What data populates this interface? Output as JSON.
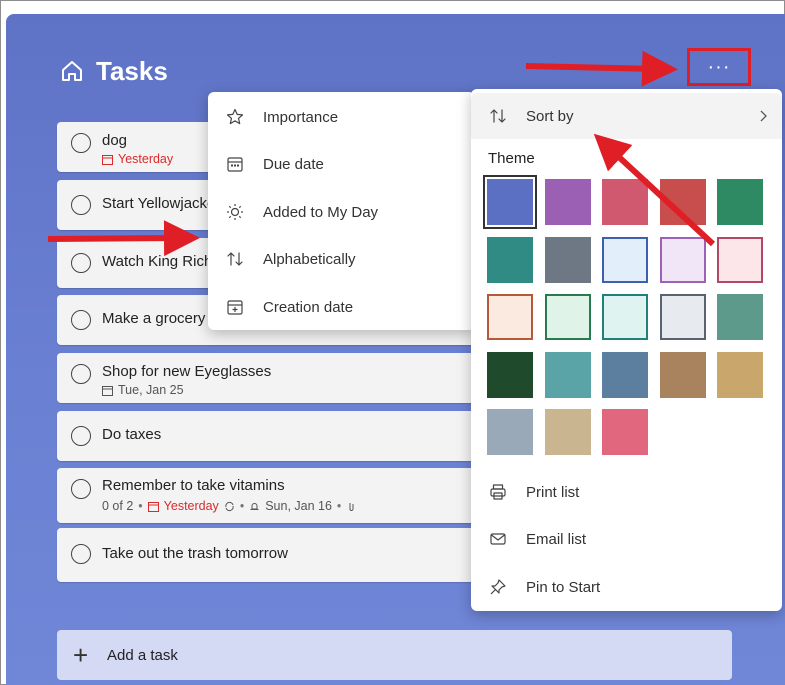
{
  "app": {
    "title": "Tasks",
    "more_label": "···"
  },
  "tasks": [
    {
      "title": "dog",
      "due": "Yesterday",
      "due_overdue": true
    },
    {
      "title": "Start Yellowjackets"
    },
    {
      "title": "Watch King Richard"
    },
    {
      "title": "Make a grocery list"
    },
    {
      "title": "Shop for new Eyeglasses",
      "due": "Tue, Jan 25",
      "due_overdue": false
    },
    {
      "title": "Do taxes"
    },
    {
      "title": "Remember to take vitamins",
      "steps": "0 of 2",
      "due": "Yesterday",
      "due_overdue": true,
      "reminder": "Sun, Jan 16"
    },
    {
      "title": "Take out the trash tomorrow"
    }
  ],
  "add_task": {
    "label": "Add a task"
  },
  "sort_menu": {
    "items": [
      {
        "label": "Importance",
        "icon": "star-icon"
      },
      {
        "label": "Due date",
        "icon": "calendar-icon"
      },
      {
        "label": "Added to My Day",
        "icon": "sun-icon"
      },
      {
        "label": "Alphabetically",
        "icon": "sort-arrows-icon"
      },
      {
        "label": "Creation date",
        "icon": "calendar-add-icon"
      }
    ]
  },
  "list_menu": {
    "sort_by": "Sort by",
    "theme_label": "Theme",
    "print": "Print list",
    "email": "Email list",
    "pin": "Pin to Start"
  },
  "themes": [
    {
      "name": "blue",
      "color": "#5b6fc3",
      "selected": true
    },
    {
      "name": "purple",
      "color": "#9b5fb4"
    },
    {
      "name": "pink",
      "color": "#d0596f"
    },
    {
      "name": "red",
      "color": "#c84e4e"
    },
    {
      "name": "green",
      "color": "#2e8a62"
    },
    {
      "name": "teal",
      "color": "#2f8b84"
    },
    {
      "name": "gray",
      "color": "#6e7884"
    },
    {
      "name": "light-blue",
      "color": "#e3eefb",
      "border": "#3d5fb0"
    },
    {
      "name": "light-purple",
      "color": "#f1e6f7",
      "border": "#9a63b8"
    },
    {
      "name": "light-pink",
      "color": "#fce6ea",
      "border": "#b24866"
    },
    {
      "name": "light-orange",
      "color": "#fbeae0",
      "border": "#b45a3a"
    },
    {
      "name": "light-green",
      "color": "#e0f3e8",
      "border": "#2a7a4f"
    },
    {
      "name": "light-teal",
      "color": "#dff3f1",
      "border": "#22807a"
    },
    {
      "name": "light-gray",
      "color": "#e7eaee",
      "border": "#5a6270"
    },
    {
      "name": "photo-tower",
      "color": "#5d9a8c"
    },
    {
      "name": "photo-leaves",
      "color": "#1f4a2b"
    },
    {
      "name": "photo-beach",
      "color": "#5aa3a6"
    },
    {
      "name": "photo-mountains",
      "color": "#5c7fa0"
    },
    {
      "name": "photo-palm-sunset",
      "color": "#a9825e"
    },
    {
      "name": "photo-desert",
      "color": "#c8a66c"
    },
    {
      "name": "photo-lighthouse",
      "color": "#9aa9b8"
    },
    {
      "name": "photo-poppy",
      "color": "#c9b690"
    },
    {
      "name": "photo-pink-abstract",
      "color": "#e0677e"
    }
  ]
}
